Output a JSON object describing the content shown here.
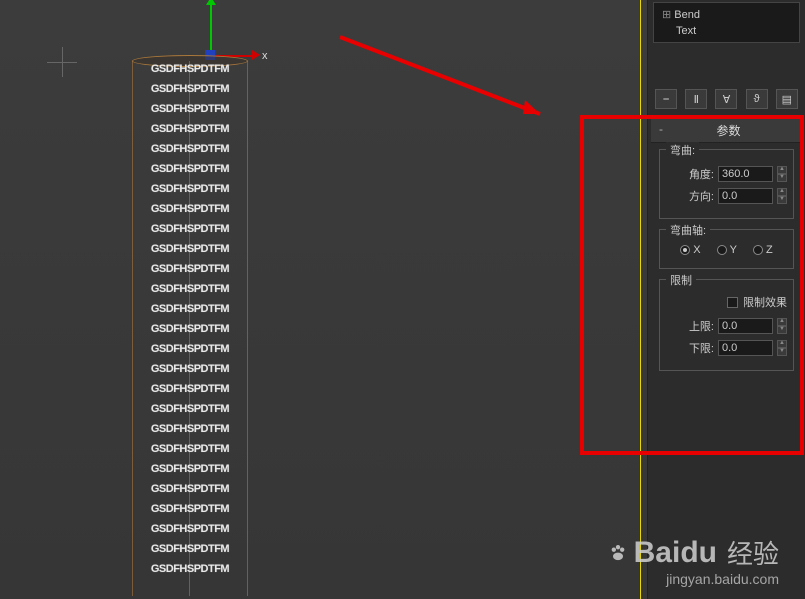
{
  "modifier_stack": {
    "item1": "Bend",
    "item2": "Text"
  },
  "rollout": {
    "title": "参数",
    "bend_group": {
      "title": "弯曲:",
      "angle_label": "角度:",
      "angle_value": "360.0",
      "direction_label": "方向:",
      "direction_value": "0.0"
    },
    "axis_group": {
      "title": "弯曲轴:",
      "x": "X",
      "y": "Y",
      "z": "Z"
    },
    "limit_group": {
      "title": "限制",
      "effect_label": "限制效果",
      "upper_label": "上限:",
      "upper_value": "0.0",
      "lower_label": "下限:",
      "lower_value": "0.0"
    }
  },
  "gizmo": {
    "x_label": "x"
  },
  "viewport": {
    "text_ring": "GSDFHSPDTFM"
  },
  "watermark": {
    "brand": "Baidu",
    "product": "经验",
    "url": "jingyan.baidu.com"
  },
  "chart_data": {
    "type": "other",
    "note": "not a chart"
  }
}
